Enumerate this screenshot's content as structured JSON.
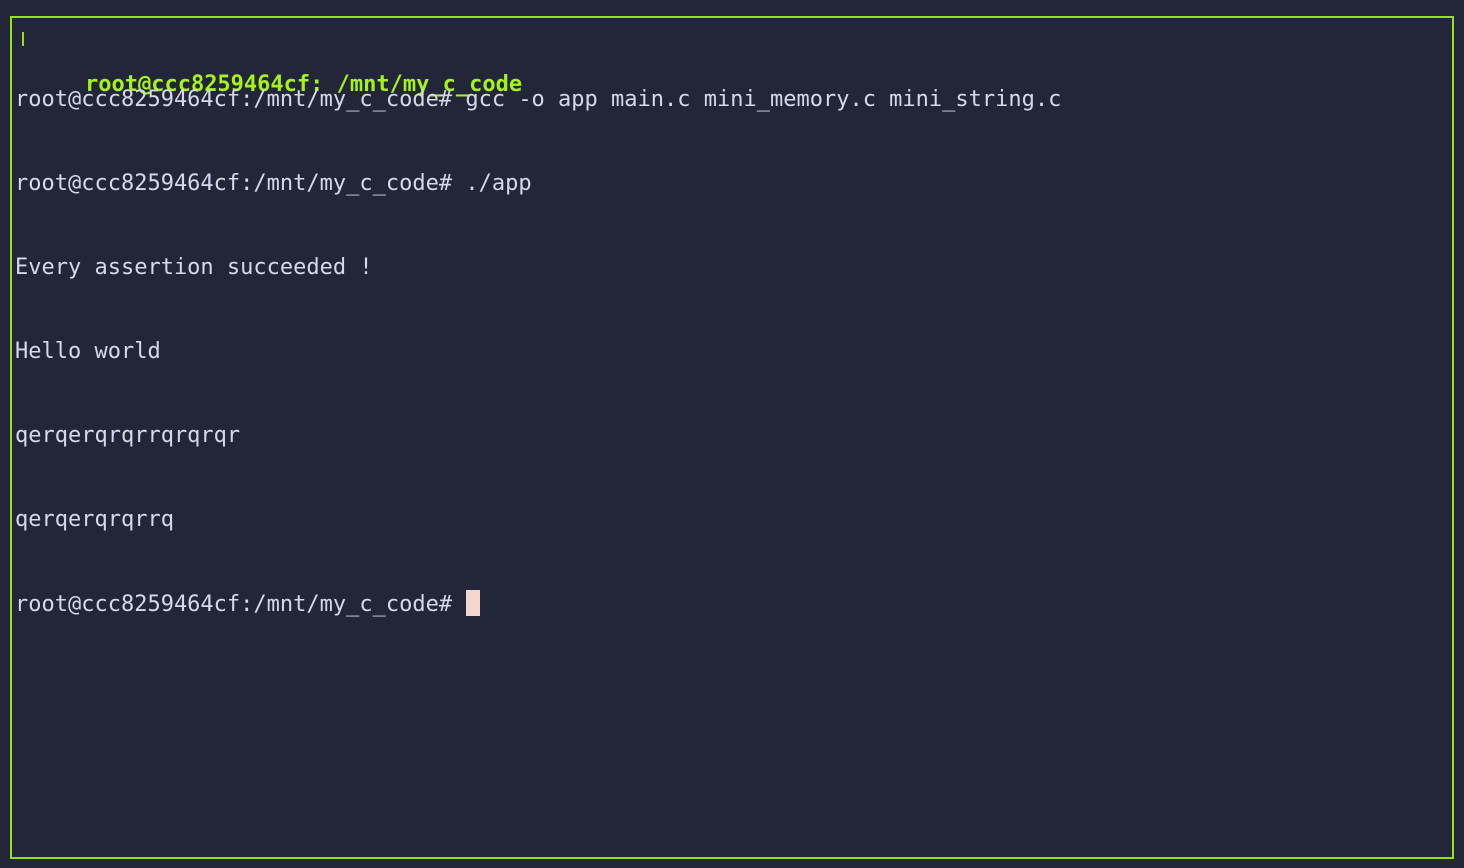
{
  "window": {
    "title": "root@ccc8259464cf: /mnt/my_c_code"
  },
  "terminal": {
    "lines": [
      "root@ccc8259464cf:/mnt/my_c_code# gcc -o app main.c mini_memory.c mini_string.c",
      "root@ccc8259464cf:/mnt/my_c_code# ./app",
      "Every assertion succeeded !",
      "Hello world",
      "qerqerqrqrrqrqrqr",
      "qerqerqrqrrq"
    ],
    "prompt": "root@ccc8259464cf:/mnt/my_c_code# "
  },
  "colors": {
    "background": "#232639",
    "border": "#96e01e",
    "title": "#a6f21f",
    "text": "#d5d9e6",
    "cursor": "#f4d6cf"
  }
}
